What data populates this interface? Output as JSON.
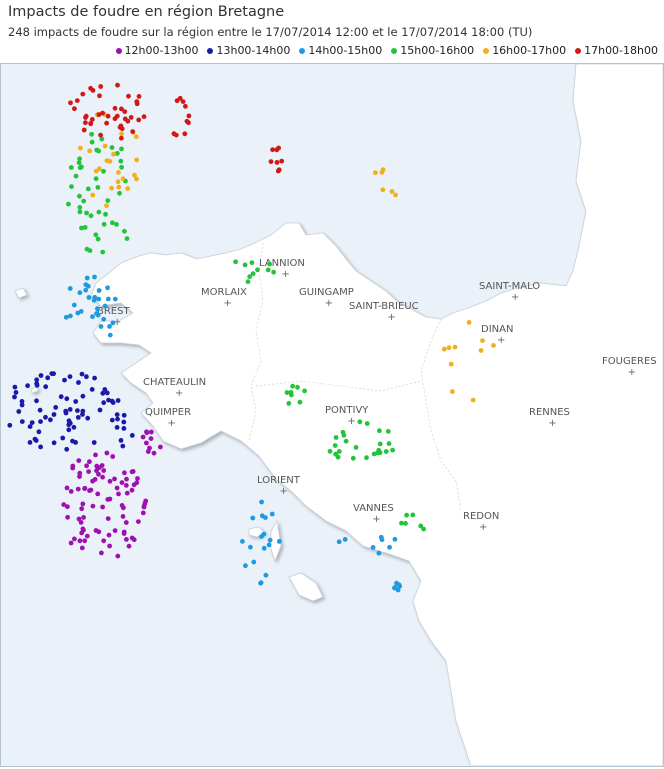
{
  "title": "Impacts de foudre en région Bretagne",
  "subtitle": "248 impacts de foudre sur la région entre le 17/07/2014 12:00 et le 17/07/2014 18:00 (TU)",
  "legend": [
    {
      "label": "12h00-13h00",
      "color": "#a010b0"
    },
    {
      "label": "13h00-14h00",
      "color": "#1a1aa8"
    },
    {
      "label": "14h00-15h00",
      "color": "#1e9be0"
    },
    {
      "label": "15h00-16h00",
      "color": "#22c43a"
    },
    {
      "label": "16h00-17h00",
      "color": "#f0b01e"
    },
    {
      "label": "17h00-18h00",
      "color": "#d01818"
    }
  ],
  "cities": [
    "LANNION",
    "MORLAIX",
    "GUINGAMP",
    "SAINT-MALO",
    "SAINT-BRIEUC",
    "DINAN",
    "BREST",
    "FOUGERES",
    "CHATEAULIN",
    "RENNES",
    "QUIMPER",
    "PONTIVY",
    "LORIENT",
    "VANNES",
    "REDON"
  ],
  "colors": {
    "sea": "#eaf1f8",
    "land": "#ffffff",
    "coast_shadow": "#c7ccd3",
    "border": "#b5c3d2"
  }
}
